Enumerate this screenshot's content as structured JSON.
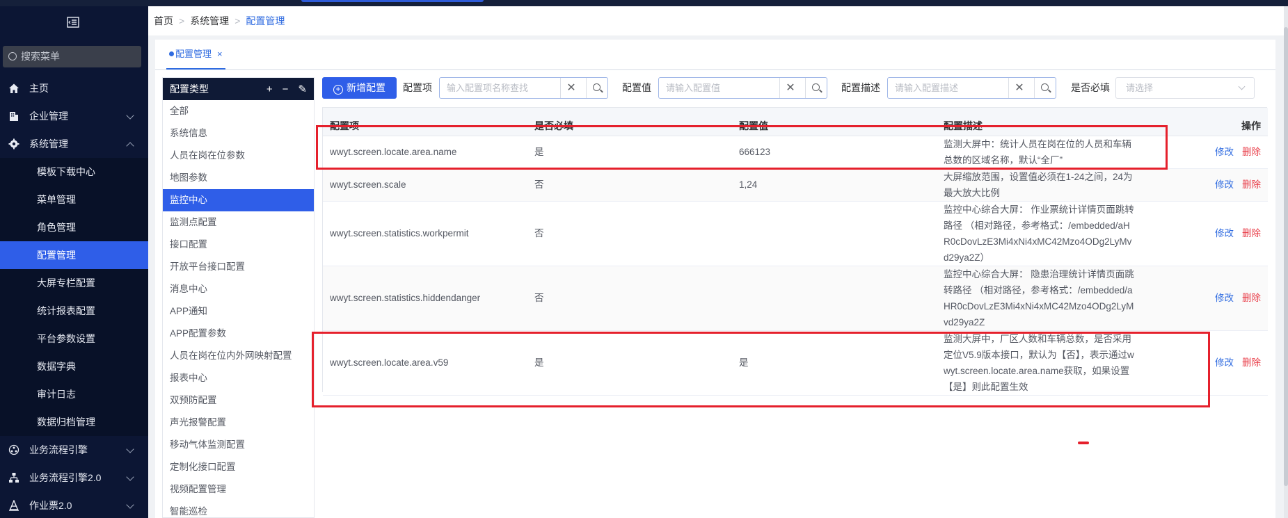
{
  "sidebar": {
    "search_placeholder": "搜索菜单",
    "items": [
      {
        "label": "主页",
        "icon": "home-icon"
      },
      {
        "label": "企业管理",
        "icon": "building-icon"
      },
      {
        "label": "系统管理",
        "icon": "gear-icon"
      }
    ],
    "sub_items": [
      "模板下载中心",
      "菜单管理",
      "角色管理",
      "配置管理",
      "大屏专栏配置",
      "统计报表配置",
      "平台参数设置",
      "数据字典",
      "审计日志",
      "数据归档管理"
    ],
    "bottom_items": [
      {
        "label": "业务流程引擎",
        "icon": "workflow-icon"
      },
      {
        "label": "业务流程引擎2.0",
        "icon": "flow-chart-icon"
      },
      {
        "label": "作业票2.0",
        "icon": "cone-icon"
      }
    ]
  },
  "breadcrumb": {
    "home": "首页",
    "level2": "系统管理",
    "current": "配置管理"
  },
  "tab": {
    "label": "配置管理",
    "close": "×"
  },
  "type_panel": {
    "title": "配置类型",
    "items": [
      "全部",
      "系统信息",
      "人员在岗在位参数",
      "地图参数",
      "监控中心",
      "监测点配置",
      "接口配置",
      "开放平台接口配置",
      "消息中心",
      "APP通知",
      "APP配置参数",
      "人员在岗在位内外网映射配置",
      "报表中心",
      "双预防配置",
      "声光报警配置",
      "移动气体监测配置",
      "定制化接口配置",
      "视频配置管理",
      "智能巡检"
    ]
  },
  "toolbar": {
    "add_label": "新增配置",
    "f1_label": "配置项",
    "f1_placeholder": "输入配置项名称查找",
    "f2_label": "配置值",
    "f2_placeholder": "请输入配置值",
    "f3_label": "配置描述",
    "f3_placeholder": "请输入配置描述",
    "f4_label": "是否必填",
    "f4_placeholder": "请选择"
  },
  "table": {
    "headers": [
      "配置项",
      "是否必填",
      "配置值",
      "配置描述",
      "操作"
    ],
    "edit_label": "修改",
    "delete_label": "删除",
    "rows": [
      {
        "key": "wwyt.screen.locate.area.name",
        "required": "是",
        "value": "666123",
        "desc": "监测大屏中：统计人员在岗在位的人员和车辆总数的区域名称，默认“全厂”"
      },
      {
        "key": "wwyt.screen.scale",
        "required": "否",
        "value": "1,24",
        "desc": "大屏缩放范围，设置值必须在1-24之间，24为最大放大比例"
      },
      {
        "key": "wwyt.screen.statistics.workpermit",
        "required": "否",
        "value": "",
        "desc": "监控中心综合大屏： 作业票统计详情页面跳转路径 （相对路径，参考格式：/embedded/aHR0cDovLzE3Mi4xNi4xMC42Mzo4ODg2LyMvd29ya2Z）"
      },
      {
        "key": "wwyt.screen.statistics.hiddendanger",
        "required": "否",
        "value": "",
        "desc": "监控中心综合大屏： 隐患治理统计详情页面跳转路径 （相对路径，参考格式：/embedded/aHR0cDovLzE3Mi4xNi4xMC42Mzo4ODg2LyMvd29ya2Z"
      },
      {
        "key": "wwyt.screen.locate.area.v59",
        "required": "是",
        "value": "是",
        "desc": "监测大屏中，厂区人数和车辆总数，是否采用定位V5.9版本接口，默认为【否】，表示通过wwyt.screen.locate.area.name获取，如果设置【是】则此配置生效"
      }
    ]
  },
  "colors": {
    "accent": "#2f5ee8",
    "sidebar_bg": "#0c1634",
    "danger": "#e9414c",
    "annotation": "#e5202c"
  }
}
